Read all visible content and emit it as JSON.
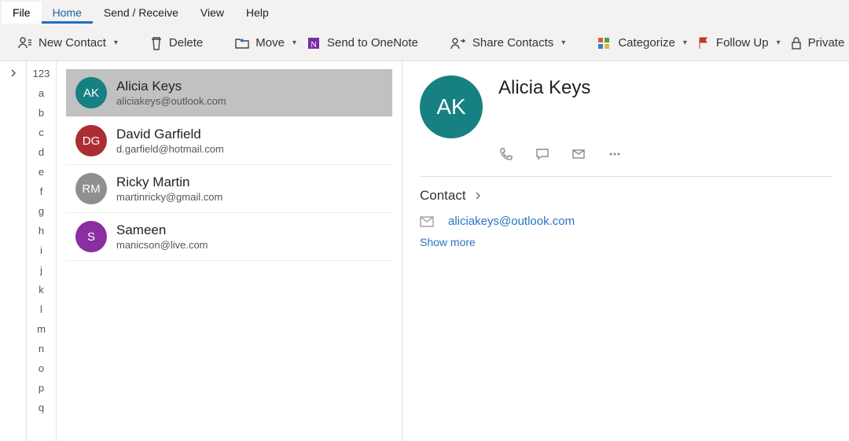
{
  "menu": {
    "file": "File",
    "home": "Home",
    "sendreceive": "Send / Receive",
    "view": "View",
    "help": "Help"
  },
  "toolbar": {
    "new_contact": "New Contact",
    "delete": "Delete",
    "move": "Move",
    "send_onenote": "Send to OneNote",
    "share_contacts": "Share Contacts",
    "categorize": "Categorize",
    "follow_up": "Follow Up",
    "private": "Private"
  },
  "alpha": {
    "head": "123",
    "items": [
      "a",
      "b",
      "c",
      "d",
      "e",
      "f",
      "g",
      "h",
      "i",
      "j",
      "k",
      "l",
      "m",
      "n",
      "o",
      "p",
      "q"
    ]
  },
  "contacts": [
    {
      "initials": "AK",
      "name": "Alicia Keys",
      "email": "aliciakeys@outlook.com",
      "color": "#168082",
      "selected": true
    },
    {
      "initials": "DG",
      "name": "David Garfield",
      "email": "d.garfield@hotmail.com",
      "color": "#ad2d34",
      "selected": false
    },
    {
      "initials": "RM",
      "name": "Ricky Martin",
      "email": "martinricky@gmail.com",
      "color": "#8f8f8f",
      "selected": false
    },
    {
      "initials": "S",
      "name": "Sameen",
      "email": "manicson@live.com",
      "color": "#8b2fa0",
      "selected": false
    }
  ],
  "detail": {
    "initials": "AK",
    "name": "Alicia Keys",
    "section_label": "Contact",
    "email": "aliciakeys@outlook.com",
    "show_more": "Show more"
  }
}
